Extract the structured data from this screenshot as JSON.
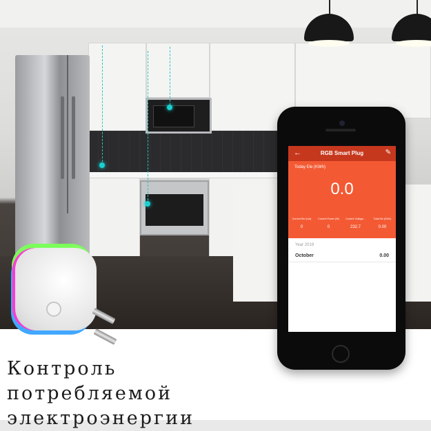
{
  "app": {
    "title": "RGB Smart Plug",
    "back_icon": "arrow-left-icon",
    "edit_icon": "pencil-icon"
  },
  "today": {
    "label": "Today Ele (KWh)",
    "value": "0.0"
  },
  "stats": [
    {
      "label": "Current Ele (mA)",
      "value": "0"
    },
    {
      "label": "Current Power (W)",
      "value": "0"
    },
    {
      "label": "Current Voltage...",
      "value": "232.7"
    },
    {
      "label": "Total Ele (KWh)",
      "value": "0.00"
    }
  ],
  "history": {
    "year_label": "Year 2019",
    "rows": [
      {
        "month": "October",
        "value": "0.00"
      }
    ]
  },
  "caption": {
    "line1": "Контроль потребляемой",
    "line2": "электроэнергии"
  },
  "colors": {
    "appbar": "#c6381e",
    "panel": "#f35a34",
    "guide": "#19d0d0"
  }
}
